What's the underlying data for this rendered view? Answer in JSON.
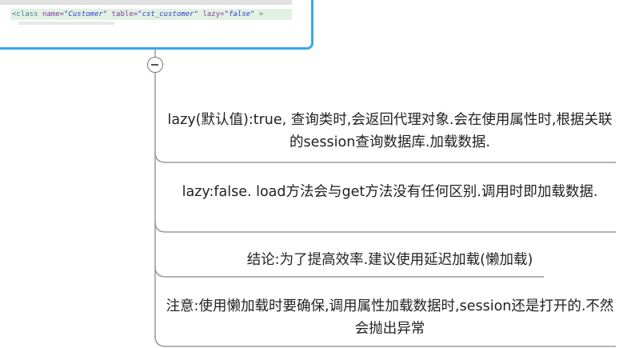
{
  "code_card": {
    "tag_open": "<class",
    "name_attr": "name=",
    "name_value": "\"Customer\"",
    "table_attr": "table=",
    "table_value": "\"cst_customer\"",
    "lazy_attr": "lazy=",
    "lazy_value": "\"false\"",
    "tag_close": ">"
  },
  "topics": [
    {
      "text": "lazy(默认值):true, 查询类时,会返回代理对象.会在使用属性时,根据关联的session查询数据库.加载数据."
    },
    {
      "text": "lazy:false. load方法会与get方法没有任何区别.调用时即加载数据."
    },
    {
      "text": "结论:为了提高效率.建议使用延迟加载(懒加载)"
    },
    {
      "text": "注意:使用懒加载时要确保,调用属性加载数据时,session还是打开的.不然会抛出异常"
    }
  ],
  "colors": {
    "card_border": "#37a9ea",
    "connector": "#9a9a9a",
    "code_highlight": "#e3f1e3"
  }
}
